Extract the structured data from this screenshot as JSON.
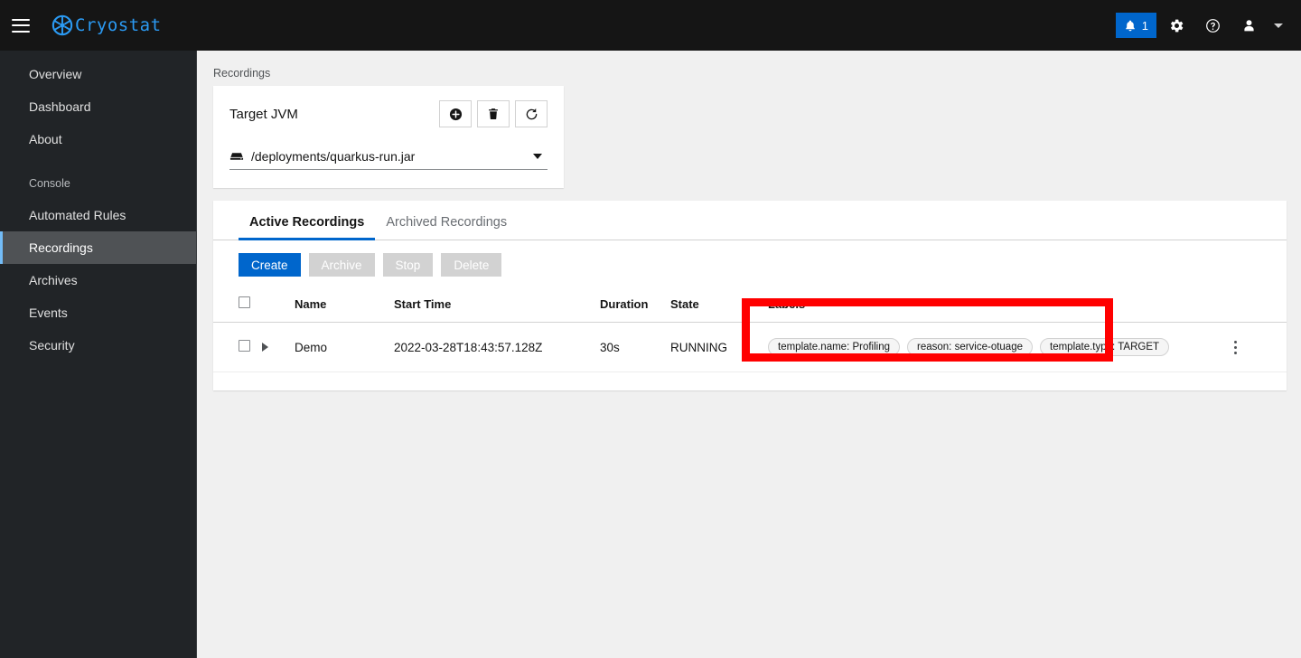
{
  "masthead": {
    "nav_toggle_name": "Global navigation toggle",
    "brand_name": "Cryostat",
    "notification_count": "1",
    "notification_icon": "bell-icon",
    "settings_icon": "gear-icon",
    "help_icon": "help-circle-icon",
    "user_icon": "user-avatar-icon",
    "caret_icon": "chevron-down-icon",
    "accent_color": "#0066cc",
    "brand_color": "#2b9af3"
  },
  "sidebar": {
    "items": [
      {
        "label": "Overview",
        "active": false
      },
      {
        "label": "Dashboard",
        "active": false
      },
      {
        "label": "About",
        "active": false
      }
    ],
    "group_title": "Console",
    "group_items": [
      {
        "label": "Automated Rules",
        "active": false
      },
      {
        "label": "Recordings",
        "active": true
      },
      {
        "label": "Archives",
        "active": false
      },
      {
        "label": "Events",
        "active": false
      },
      {
        "label": "Security",
        "active": false
      }
    ],
    "active_color": "#73bcf7"
  },
  "breadcrumb": "Recordings",
  "target_card": {
    "label": "Target JVM",
    "actions": [
      {
        "name": "create-target-button",
        "icon": "plus-circle-icon"
      },
      {
        "name": "delete-target-button",
        "icon": "trash-icon"
      },
      {
        "name": "refresh-targets-button",
        "icon": "refresh-icon"
      }
    ],
    "select": {
      "icon": "server-icon",
      "value": "/deployments/quarkus-run.jar",
      "caret": "caret-down-icon"
    }
  },
  "recordings": {
    "tabs": [
      {
        "label": "Active Recordings",
        "active": true
      },
      {
        "label": "Archived Recordings",
        "active": false
      }
    ],
    "buttons": [
      {
        "label": "Create",
        "state": "enabled"
      },
      {
        "label": "Archive",
        "state": "disabled"
      },
      {
        "label": "Stop",
        "state": "disabled"
      },
      {
        "label": "Delete",
        "state": "disabled"
      }
    ],
    "columns": [
      "Name",
      "Start Time",
      "Duration",
      "State",
      "Labels"
    ],
    "rows": [
      {
        "name": "Demo",
        "start_time": "2022-03-28T18:43:57.128Z",
        "duration": "30s",
        "state": "RUNNING",
        "labels": [
          "template.name: Profiling",
          "reason: service-otuage",
          "template.type: TARGET"
        ]
      }
    ]
  },
  "annotation": {
    "highlight_color": "#ff0000",
    "highlight_target": "labels-cell"
  }
}
